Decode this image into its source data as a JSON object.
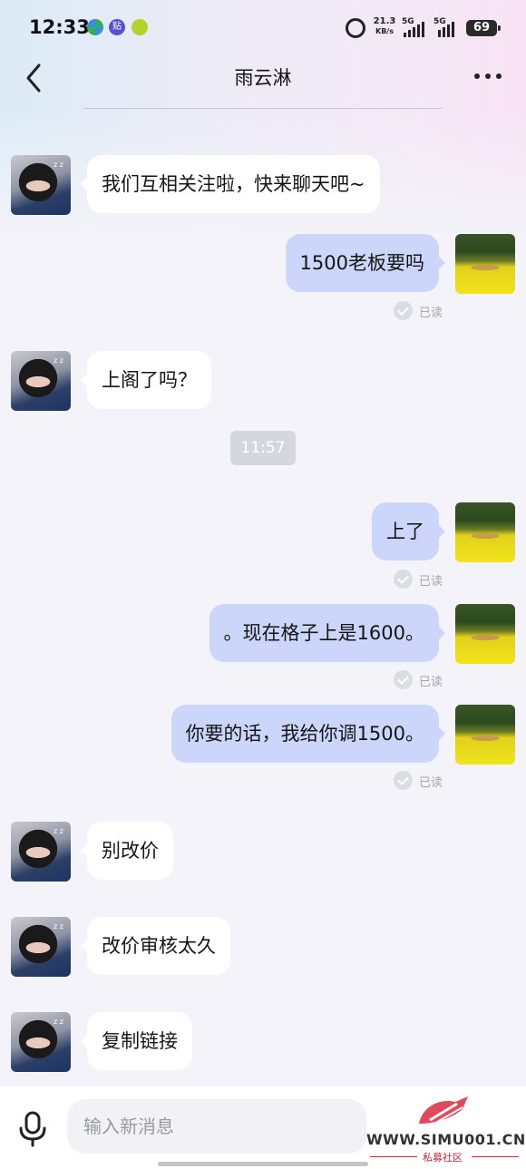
{
  "status_bar": {
    "time": "12:33",
    "net_speed_value": "21.3",
    "net_speed_unit": "KB/s",
    "sim1": "5G",
    "sim2": "5G",
    "battery": "69"
  },
  "header": {
    "title": "雨云淋"
  },
  "timestamp": "11:57",
  "read_label": "已读",
  "messages": [
    {
      "side": "in",
      "text": "我们互相关注啦，快来聊天吧~"
    },
    {
      "side": "out",
      "text": "1500老板要吗",
      "status": "已读"
    },
    {
      "side": "in",
      "text": "上阁了吗？"
    },
    {
      "side": "out",
      "text": "上了",
      "status": "已读"
    },
    {
      "side": "out",
      "text": "。现在格子上是1600。",
      "status": "已读"
    },
    {
      "side": "out",
      "text": "你要的话，我给你调1500。",
      "status": "已读"
    },
    {
      "side": "in",
      "text": "别改价"
    },
    {
      "side": "in",
      "text": "改价审核太久"
    },
    {
      "side": "in",
      "text": "复制链接"
    }
  ],
  "input": {
    "placeholder": "输入新消息"
  },
  "watermark": {
    "url": "WWW.SIMU001.CN",
    "subtitle": "私募社区"
  },
  "colors": {
    "outgoing_bubble": "#ccd6fb",
    "incoming_bubble": "#ffffff",
    "background": "#f3f3f9"
  }
}
